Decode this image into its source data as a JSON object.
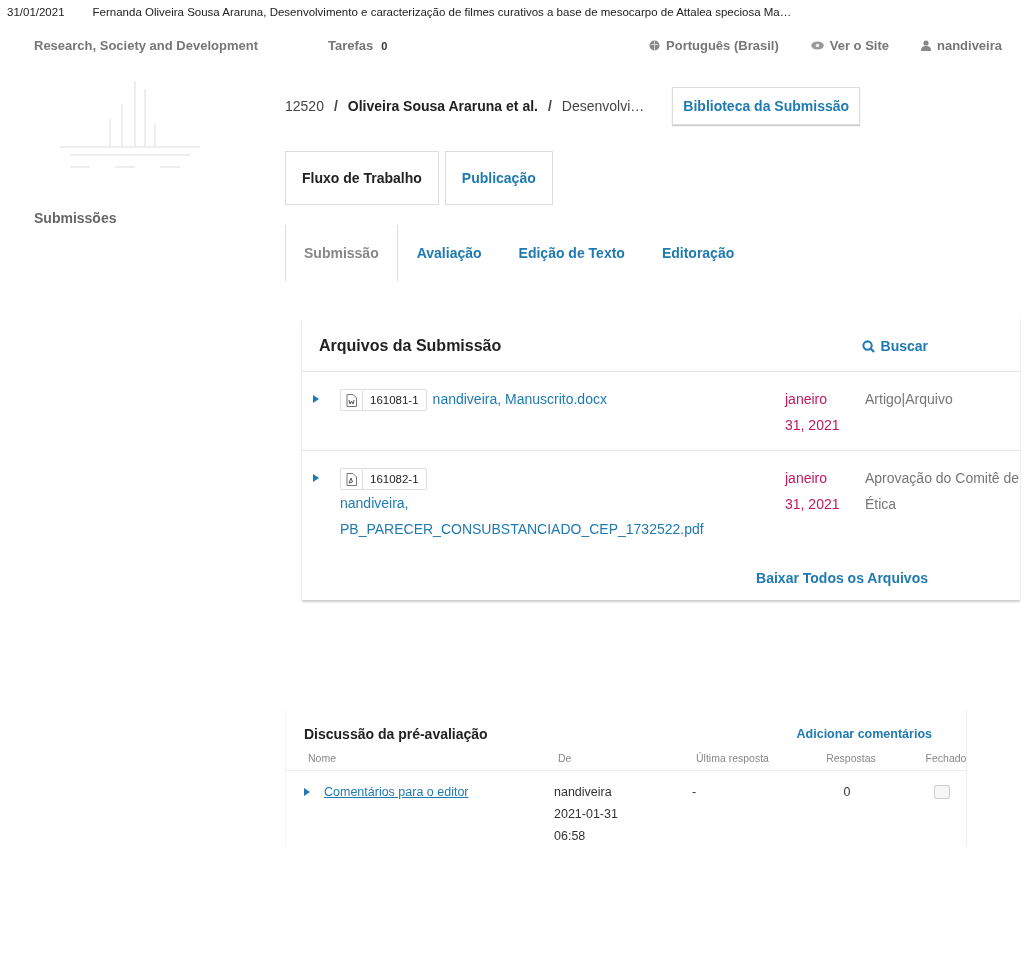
{
  "print_header": {
    "date": "31/01/2021",
    "title": "Fernanda Oliveira Sousa Araruna, Desenvolvimento e caracterização de filmes curativos a base de mesocarpo de Attalea speciosa Ma…"
  },
  "navbar": {
    "site": "Research, Society and Development",
    "tasks_label": "Tarefas",
    "tasks_count": "0",
    "language": "Português (Brasil)",
    "view_site": "Ver o Site",
    "user": "nandiveira"
  },
  "breadcrumb": {
    "separator": "/",
    "id": "12520",
    "authors": "Oliveira Sousa Araruna et al.",
    "title": "Desenvolvi…"
  },
  "library_button": "Biblioteca da Submissão",
  "sidebar": {
    "items": [
      "Submissões"
    ]
  },
  "tabs": [
    {
      "label": "Fluxo de Trabalho",
      "selected": true
    },
    {
      "label": "Publicação",
      "selected": false
    }
  ],
  "subtabs": [
    {
      "label": "Submissão",
      "selected": true
    },
    {
      "label": "Avaliação",
      "selected": false
    },
    {
      "label": "Edição de Texto",
      "selected": false
    },
    {
      "label": "Editoração",
      "selected": false
    }
  ],
  "files_panel": {
    "title": "Arquivos da Submissão",
    "search": "Buscar",
    "download_all": "Baixar Todos os Arquivos",
    "rows": [
      {
        "kind": "word",
        "id": "161081-1",
        "name": "nandiveira, Manuscrito.docx",
        "date": "janeiro 31, 2021",
        "type": "Artigo|Arquivo"
      },
      {
        "kind": "pdf",
        "id": "161082-1",
        "name": "nandiveira, PB_PARECER_CONSUBSTANCIADO_CEP_1732522.pdf",
        "date": "janeiro 31, 2021",
        "type": "Aprovação do Comitê de Ética"
      }
    ]
  },
  "discussion": {
    "title": "Discussão da pré-avaliação",
    "add": "Adicionar comentários",
    "columns": [
      "Nome",
      "De",
      "Última resposta",
      "Respostas",
      "Fechado"
    ],
    "rows": [
      {
        "name": "Comentários para o editor",
        "from": "nandiveira 2021-01-31 06:58",
        "last_reply": "-",
        "replies": "0",
        "closed": false
      }
    ]
  }
}
